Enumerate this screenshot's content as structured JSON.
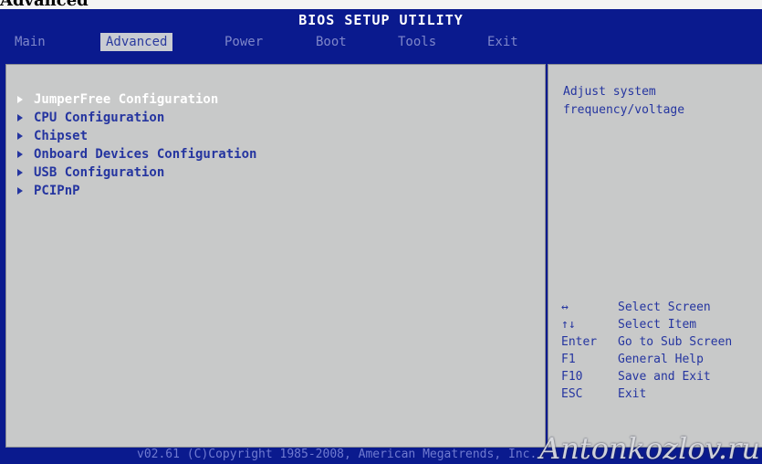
{
  "header_word": "Advanced",
  "title": "BIOS SETUP UTILITY",
  "tabs": [
    "Main",
    "Advanced",
    "Power",
    "Boot",
    "Tools",
    "Exit"
  ],
  "active_tab": "Advanced",
  "menu": {
    "items": [
      {
        "label": "JumperFree Configuration",
        "selected": true
      },
      {
        "label": "CPU Configuration",
        "selected": false
      },
      {
        "label": "Chipset",
        "selected": false
      },
      {
        "label": "Onboard Devices Configuration",
        "selected": false
      },
      {
        "label": "USB Configuration",
        "selected": false
      },
      {
        "label": "PCIPnP",
        "selected": false
      }
    ]
  },
  "help": {
    "text": "Adjust system\nfrequency/voltage"
  },
  "keys": [
    {
      "key": "↔",
      "action": "Select Screen"
    },
    {
      "key": "↑↓",
      "action": "Select Item"
    },
    {
      "key": "Enter",
      "action": "Go to Sub Screen"
    },
    {
      "key": "F1",
      "action": "General Help"
    },
    {
      "key": "F10",
      "action": "Save and Exit"
    },
    {
      "key": "ESC",
      "action": "Exit"
    }
  ],
  "footer": "v02.61 (C)Copyright 1985-2008, American Megatrends, Inc.",
  "watermark": "Antonkozlov.ru",
  "colors": {
    "screen_bg": "#0a1a8e",
    "panel_bg": "#c8c9c9",
    "text_blue": "#2535a0",
    "selected_text": "#ffffff"
  }
}
